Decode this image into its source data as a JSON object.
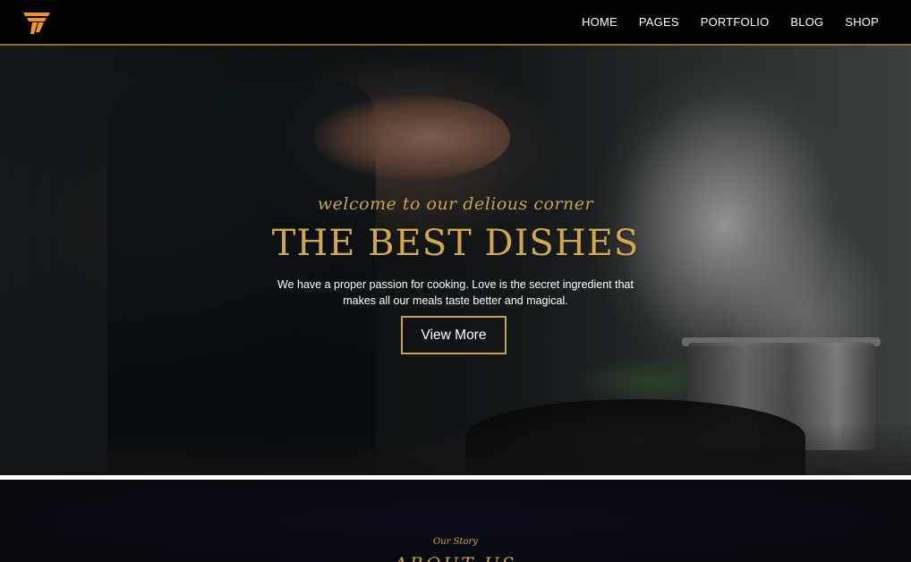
{
  "nav": {
    "logo_icon": "brand-logo-icon",
    "items": [
      {
        "label": "HOME"
      },
      {
        "label": "PAGES"
      },
      {
        "label": "PORTFOLIO"
      },
      {
        "label": "BLOG"
      },
      {
        "label": "SHOP"
      }
    ]
  },
  "hero": {
    "tagline": "welcome to our delious corner",
    "title": "THE BEST DISHES",
    "description": "We have a proper passion for cooking. Love is the secret ingredient that makes all our meals taste better and magical.",
    "button_label": "View More"
  },
  "about": {
    "eyebrow": "Our Story",
    "heading": "ABOUT US"
  },
  "colors": {
    "accent_gold": "#c9a24e",
    "logo_orange": "#f0942a",
    "nav_background": "#030303",
    "section_background": "#07070c"
  }
}
